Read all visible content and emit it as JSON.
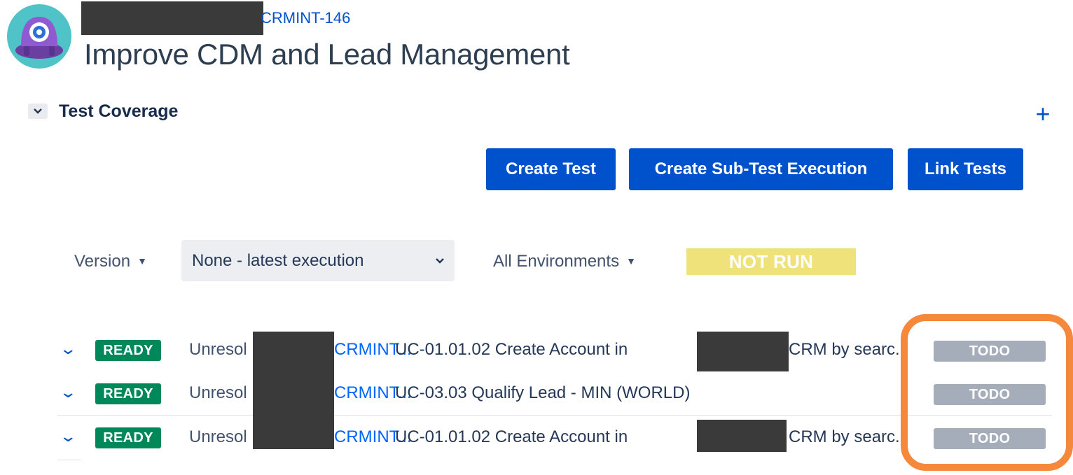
{
  "header": {
    "issue_key": "CRMINT-146",
    "title": "Improve CDM and Lead Management"
  },
  "test_coverage": {
    "section_title": "Test Coverage",
    "toggle_icon": "chevron-down-icon",
    "add_icon": "plus-icon",
    "buttons": {
      "create_test": "Create Test",
      "create_sub_test_execution": "Create Sub-Test Execution",
      "link_tests": "Link Tests"
    },
    "filters": {
      "version_label": "Version",
      "version_selected": "None - latest execution",
      "environments_label": "All Environments",
      "status_summary": "NOT RUN"
    },
    "rows": [
      {
        "status": "READY",
        "resolution": "Unresol",
        "key": "CRMINT...",
        "summary": "UC-01.01.02 Create Account in",
        "summary_tail": "CRM by searc...",
        "test_status": "TODO"
      },
      {
        "status": "READY",
        "resolution": "Unresol",
        "key": "CRMINT...",
        "summary": "UC-03.03 Qualify Lead - MIN (WORLD)",
        "summary_tail": "",
        "test_status": "TODO"
      },
      {
        "status": "READY",
        "resolution": "Unresol",
        "key": "CRMINT...",
        "summary": "UC-01.01.02 Create Account in",
        "summary_tail": "CRM by searc...",
        "test_status": "TODO"
      }
    ]
  },
  "colors": {
    "primary_button": "#0052cc",
    "ready_badge": "#00875a",
    "todo_badge": "#a5adba",
    "not_run_badge": "#f0e27a",
    "highlight_outline": "#f5883b"
  }
}
